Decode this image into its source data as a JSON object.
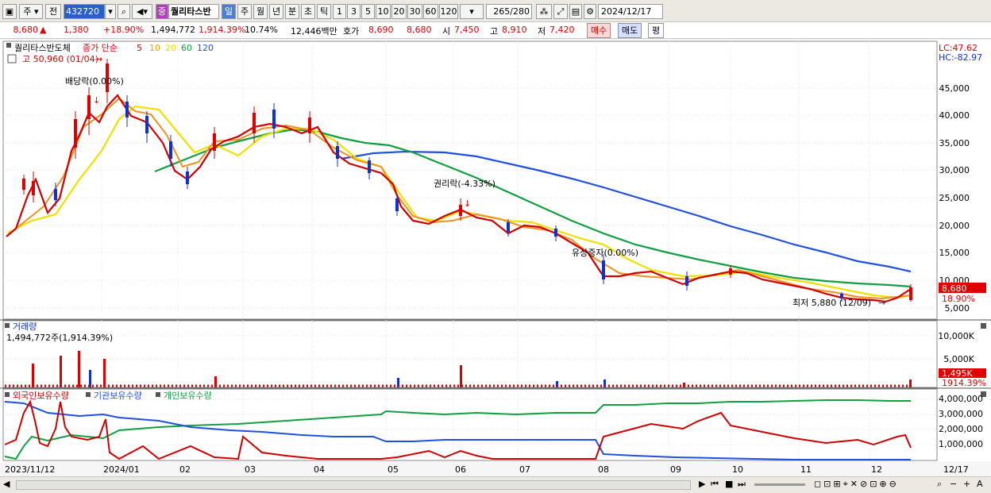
{
  "toolbar": {
    "period_type": "주",
    "prev_label": "전",
    "stock_code": "432720",
    "stock_name_badge": "중",
    "stock_name": "퀄리타스반",
    "periods": [
      "일",
      "주",
      "월",
      "년",
      "분",
      "초",
      "틱"
    ],
    "active_period": "일",
    "ticks": [
      "1",
      "3",
      "5",
      "10",
      "20",
      "30",
      "60",
      "120"
    ],
    "count": "265",
    "total": "/280",
    "date": "2024/12/17"
  },
  "info": {
    "price": "8,680",
    "change_arrow": "▲",
    "change": "1,380",
    "change_pct": "+18.90%",
    "volume": "1,494,772",
    "volume_pct": "1,914.39%",
    "turnover_pct": "10.74%",
    "amount": "12,446백만",
    "quote_label": "호가",
    "quote_ask": "8,690",
    "quote_bid": "8,680",
    "open_label": "시",
    "open": "7,450",
    "high_label": "고",
    "high": "8,910",
    "low_label": "저",
    "low": "7,420",
    "buy_label": "매수",
    "sell_label": "매도",
    "avg_label": "평"
  },
  "price_pane": {
    "name": "퀄리타스반도체",
    "legend_title": "종가 단순",
    "ma_periods": [
      "5",
      "10",
      "20",
      "60",
      "120"
    ],
    "ma_colors": [
      "#e00000",
      "#f0a000",
      "#e8e000",
      "#10a040",
      "#2050e0"
    ],
    "high_note": "고 50,960 (01/04)",
    "low_note": "최저 5,880 (12/09)",
    "dividend_note": "배당락(0.00%)",
    "rights_note": "권리락(-4.33%)",
    "capital_note": "유상증자(0.00%)",
    "lc": "LC:47.62",
    "hc": "HC:-82.97",
    "y_ticks": [
      "45,000",
      "40,000",
      "35,000",
      "30,000",
      "25,000",
      "20,000",
      "15,000",
      "10,000",
      "5,000"
    ],
    "last_price": "8,680",
    "last_pct": "18.90%"
  },
  "volume_pane": {
    "title": "거래량",
    "value": "1,494,772주(1,914.39%)",
    "y_ticks": [
      "10,000K",
      "5,000K"
    ],
    "last": "1,495K",
    "last_pct": "1914.39%"
  },
  "holding_pane": {
    "legend": [
      "외국인보유수량",
      "기관보유수량",
      "개인보유수량"
    ],
    "legend_colors": [
      "#d00000",
      "#2050e0",
      "#10a040"
    ],
    "y_ticks": [
      "4,000,000",
      "3,000,000",
      "2,000,000",
      "1,000,000"
    ]
  },
  "x_axis": {
    "labels": [
      "2023/11/12",
      "2024/01",
      "02",
      "03",
      "04",
      "05",
      "06",
      "07",
      "08",
      "09",
      "10",
      "11",
      "12"
    ],
    "right_label": "12/17"
  }
}
